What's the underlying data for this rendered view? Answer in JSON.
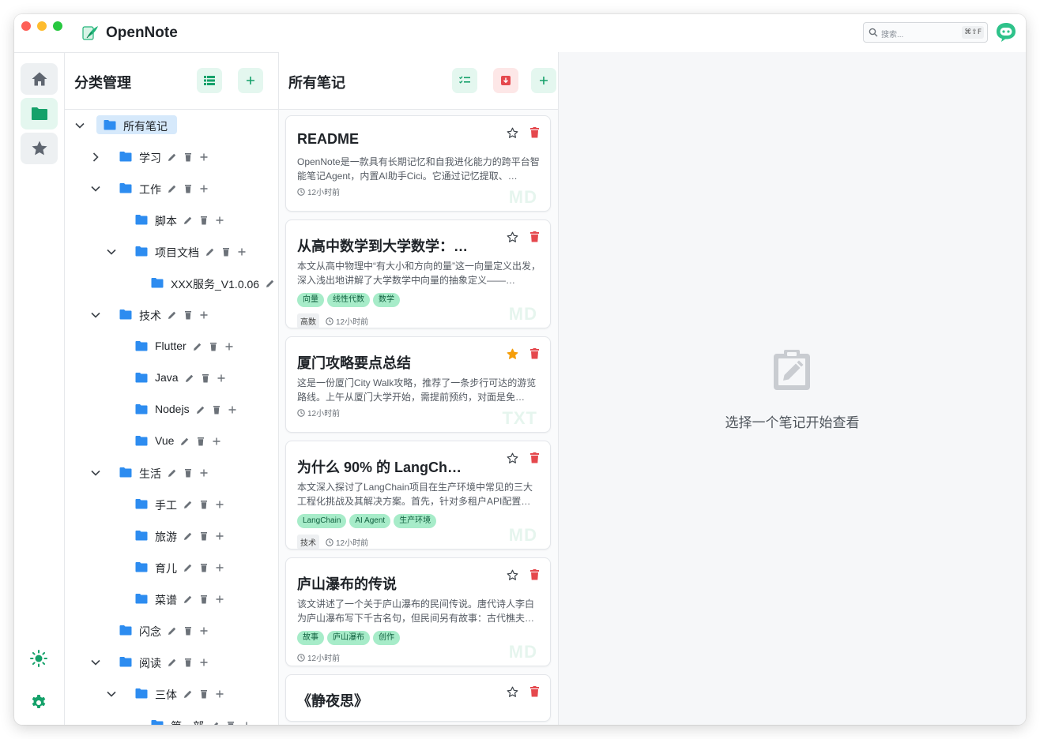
{
  "app": {
    "title": "OpenNote"
  },
  "search": {
    "placeholder": "搜索...",
    "shortcut": "⌘⇧F"
  },
  "categories": {
    "title": "分类管理",
    "tree": [
      {
        "label": "所有笔记",
        "depth": 0,
        "expand": "open",
        "selected": true,
        "actions": false
      },
      {
        "label": "学习",
        "depth": 1,
        "expand": "closed",
        "actions": true
      },
      {
        "label": "工作",
        "depth": 1,
        "expand": "open",
        "actions": true
      },
      {
        "label": "脚本",
        "depth": 2,
        "expand": "none",
        "actions": true
      },
      {
        "label": "项目文档",
        "depth": 2,
        "expand": "open",
        "actions": true
      },
      {
        "label": "XXX服务_V1.0.06",
        "depth": 3,
        "expand": "none",
        "actions": true
      },
      {
        "label": "技术",
        "depth": 1,
        "expand": "open",
        "actions": true
      },
      {
        "label": "Flutter",
        "depth": 2,
        "expand": "none",
        "actions": true
      },
      {
        "label": "Java",
        "depth": 2,
        "expand": "none",
        "actions": true
      },
      {
        "label": "Nodejs",
        "depth": 2,
        "expand": "none",
        "actions": true
      },
      {
        "label": "Vue",
        "depth": 2,
        "expand": "none",
        "actions": true
      },
      {
        "label": "生活",
        "depth": 1,
        "expand": "open",
        "actions": true
      },
      {
        "label": "手工",
        "depth": 2,
        "expand": "none",
        "actions": true
      },
      {
        "label": "旅游",
        "depth": 2,
        "expand": "none",
        "actions": true
      },
      {
        "label": "育儿",
        "depth": 2,
        "expand": "none",
        "actions": true
      },
      {
        "label": "菜谱",
        "depth": 2,
        "expand": "none",
        "actions": true
      },
      {
        "label": "闪念",
        "depth": 1,
        "expand": "none",
        "actions": true
      },
      {
        "label": "阅读",
        "depth": 1,
        "expand": "open",
        "actions": true
      },
      {
        "label": "三体",
        "depth": 2,
        "expand": "open",
        "actions": true
      },
      {
        "label": "第一部",
        "depth": 3,
        "expand": "none",
        "actions": true
      }
    ]
  },
  "notes": {
    "title": "所有笔记",
    "items": [
      {
        "title": "README",
        "desc": "OpenNote是一款具有长期记忆和自我进化能力的跨平台智能笔记Agent，内置AI助手Cici。它通过记忆提取、…",
        "tags": [],
        "category": "",
        "time": "12小时前",
        "type": "MD",
        "starred": false
      },
      {
        "title": "从高中数学到大学数学：…",
        "desc": "本文从高中物理中“有大小和方向的量”这一向量定义出发，深入浅出地讲解了大学数学中向量的抽象定义——…",
        "tags": [
          "向量",
          "线性代数",
          "数学"
        ],
        "category": "高数",
        "time": "12小时前",
        "type": "MD",
        "starred": false
      },
      {
        "title": "厦门攻略要点总结",
        "desc": "这是一份厦门City Walk攻略，推荐了一条步行可达的游览路线。上午从厦门大学开始，需提前预约，对面是免…",
        "tags": [],
        "category": "",
        "time": "12小时前",
        "type": "TXT",
        "starred": true
      },
      {
        "title": "为什么 90% 的 LangCh…",
        "desc": "本文深入探讨了LangChain项目在生产环境中常见的三大工程化挑战及其解决方案。首先，针对多租户API配置…",
        "tags": [
          "LangChain",
          "AI Agent",
          "生产环境"
        ],
        "category": "技术",
        "time": "12小时前",
        "type": "MD",
        "starred": false
      },
      {
        "title": "庐山瀑布的传说",
        "desc": "该文讲述了一个关于庐山瀑布的民间传说。唐代诗人李白为庐山瀑布写下千古名句，但民间另有故事：古代樵夫…",
        "tags": [
          "故事",
          "庐山瀑布",
          "创作"
        ],
        "category": "",
        "time": "12小时前",
        "type": "MD",
        "starred": false
      },
      {
        "title": "《静夜思》",
        "desc": "",
        "tags": [],
        "category": "",
        "time": "",
        "type": "",
        "starred": false
      }
    ]
  },
  "detail": {
    "empty_text": "选择一个笔记开始查看"
  },
  "colors": {
    "accent": "#15a16a",
    "folder": "#2d8cf0",
    "danger": "#e5484d",
    "star": "#f59e0b"
  }
}
